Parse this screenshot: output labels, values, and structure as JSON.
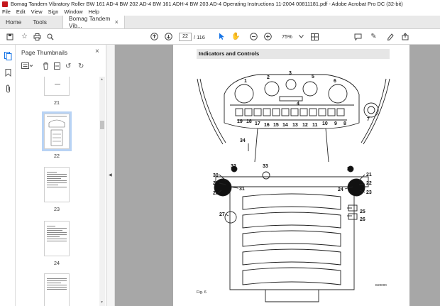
{
  "window": {
    "title": "Bomag Tandem Vibratory Roller BW 161 AD-4 BW 202 AD-4 BW 161 ADH-4 BW 203 AD-4 Operating Instructions 11-2004 00811181.pdf - Adobe Acrobat Pro DC (32-bit)"
  },
  "menu": [
    "File",
    "Edit",
    "View",
    "Sign",
    "Window",
    "Help"
  ],
  "tabs": {
    "home": "Home",
    "tools": "Tools",
    "document": "Bomag Tandem Vib...",
    "close": "×"
  },
  "toolbar": {
    "current_page": "22",
    "total_pages": "/ 116",
    "zoom": "75%",
    "icons": [
      "save-icon",
      "star-icon",
      "print-icon",
      "search-icon",
      "page-up-icon",
      "page-down-icon",
      "select-cursor-icon",
      "hand-icon",
      "zoom-out-icon",
      "zoom-in-icon",
      "zoom-dropdown-icon",
      "fit-page-icon",
      "comment-icon",
      "pen-icon",
      "highlight-icon",
      "share-icon"
    ],
    "accent": "#1473e6"
  },
  "panel": {
    "title": "Page Thumbnails",
    "close": "×",
    "thumbnails": [
      {
        "label": "21"
      },
      {
        "label": "22",
        "selected": true
      },
      {
        "label": "23"
      },
      {
        "label": "24"
      }
    ]
  },
  "document": {
    "section_title": "Indicators and Controls",
    "figure_label": "Fig. 6",
    "figure_code": "B20000",
    "callouts": [
      "1",
      "2",
      "3",
      "4",
      "5",
      "6",
      "7",
      "8",
      "9",
      "10",
      "11",
      "12",
      "13",
      "14",
      "15",
      "16",
      "17",
      "18",
      "19",
      "20",
      "21",
      "22",
      "23",
      "24",
      "25",
      "26",
      "27",
      "28",
      "29",
      "30",
      "31",
      "32",
      "33",
      "34"
    ]
  }
}
